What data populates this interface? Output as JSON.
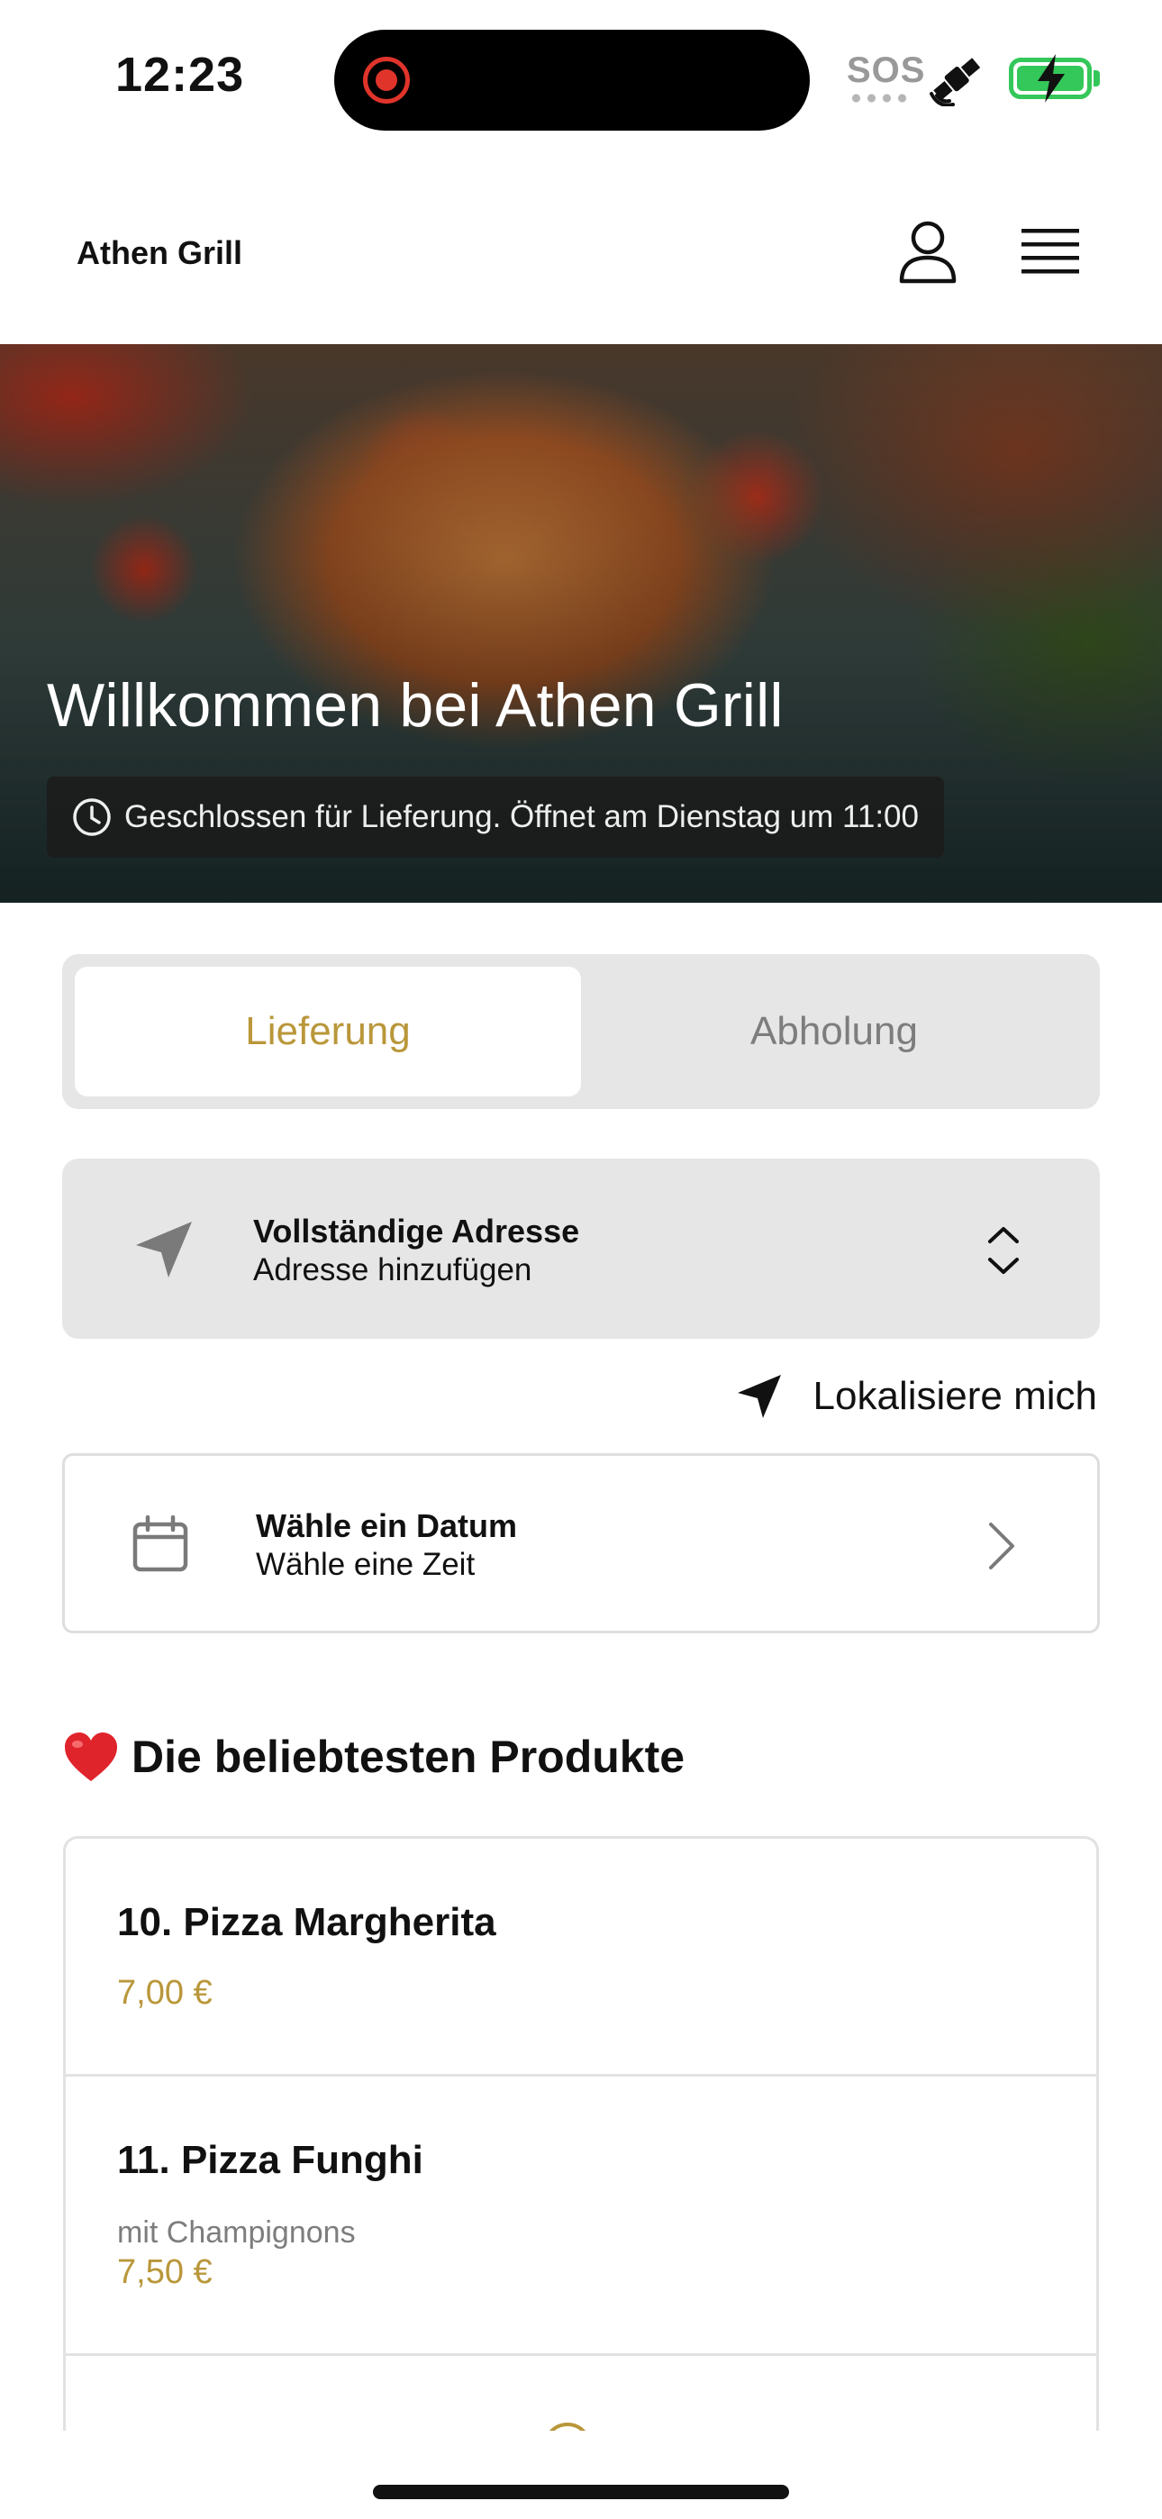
{
  "status_bar": {
    "time": "12:23",
    "sos": "SOS",
    "icons": [
      "screen-recording-icon",
      "satellite-icon",
      "battery-charging-icon"
    ],
    "battery_color": "#34c759"
  },
  "header": {
    "brand": "Athen Grill",
    "icons": [
      "user-icon",
      "menu-icon"
    ]
  },
  "hero": {
    "title": "Willkommen bei Athen Grill",
    "status": "Geschlossen für Lieferung. Öffnet am Dienstag um 11:00"
  },
  "mode_toggle": {
    "delivery_label": "Lieferung",
    "pickup_label": "Abholung",
    "selected": "Lieferung"
  },
  "address": {
    "title": "Vollständige Adresse",
    "subtitle": "Adresse hinzufügen"
  },
  "locate": {
    "label": "Lokalisiere mich"
  },
  "date": {
    "title": "Wähle ein Datum",
    "subtitle": "Wähle eine Zeit"
  },
  "popular": {
    "title": "Die beliebtesten Produkte",
    "products": [
      {
        "name": "10. Pizza Margherita",
        "description": "",
        "price": "7,00 €"
      },
      {
        "name": "11. Pizza Funghi",
        "description": "mit Champignons",
        "price": "7,50 €"
      }
    ]
  },
  "colors": {
    "accent": "#b9973a",
    "muted_text": "#7d7d7d",
    "panel_bg": "#e6e6e6"
  }
}
